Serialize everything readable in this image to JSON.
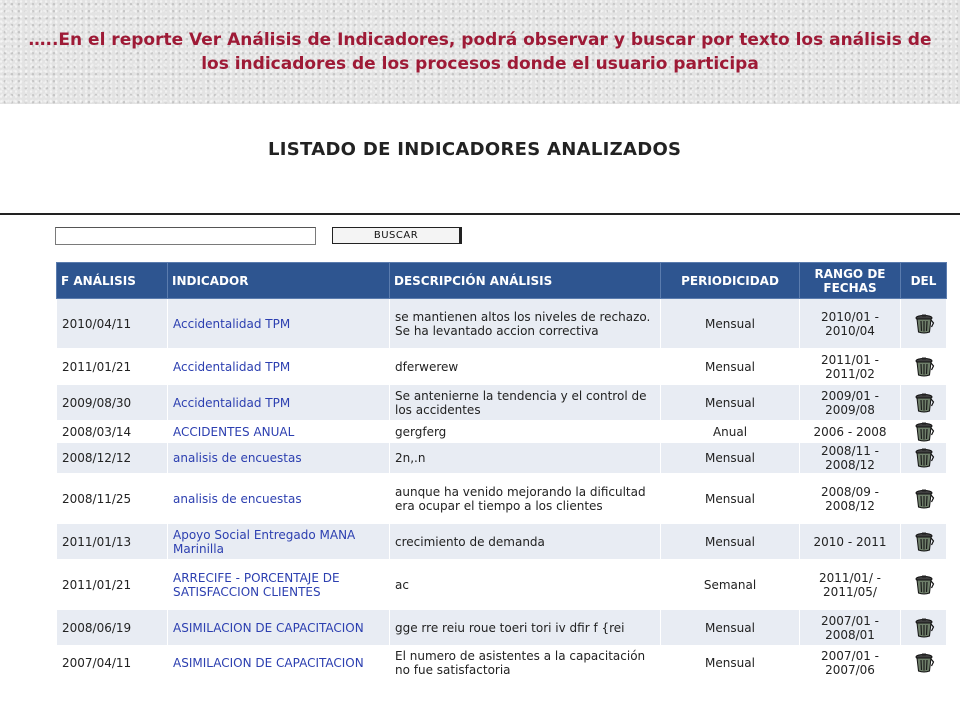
{
  "banner": {
    "text": "…..En el reporte Ver Análisis de Indicadores, podrá observar y buscar por texto los análisis de los indicadores de los procesos donde el usuario participa"
  },
  "page": {
    "title": "LISTADO DE INDICADORES ANALIZADOS"
  },
  "search": {
    "value": "",
    "button_label": "BUSCAR"
  },
  "table": {
    "headers": {
      "fecha": "F ANÁLISIS",
      "indicador": "INDICADOR",
      "descripcion": "DESCRIPCIÓN ANÁLISIS",
      "periodicidad": "PERIODICIDAD",
      "rango": "RANGO DE FECHAS",
      "del": "DEL"
    },
    "rows": [
      {
        "fecha": "2010/04/11",
        "indicador": "Accidentalidad TPM",
        "descripcion": "se mantienen altos los niveles de rechazo. Se ha levantado accion correctiva",
        "periodicidad": "Mensual",
        "rango": "2010/01 - 2010/04"
      },
      {
        "fecha": "2011/01/21",
        "indicador": "Accidentalidad TPM",
        "descripcion": "dferwerew",
        "periodicidad": "Mensual",
        "rango": "2011/01 - 2011/02"
      },
      {
        "fecha": "2009/08/30",
        "indicador": "Accidentalidad TPM",
        "descripcion": "Se antenierne la tendencia y el control de los accidentes",
        "periodicidad": "Mensual",
        "rango": "2009/01 - 2009/08"
      },
      {
        "fecha": "2008/03/14",
        "indicador": "ACCIDENTES ANUAL",
        "descripcion": "gergferg",
        "periodicidad": "Anual",
        "rango": "2006 - 2008"
      },
      {
        "fecha": "2008/12/12",
        "indicador": "analisis de encuestas",
        "descripcion": "2n,.n",
        "periodicidad": "Mensual",
        "rango": "2008/11 - 2008/12"
      },
      {
        "fecha": "2008/11/25",
        "indicador": "analisis de encuestas",
        "descripcion": "aunque ha venido mejorando la dificultad era ocupar el tiempo a los clientes",
        "periodicidad": "Mensual",
        "rango": "2008/09 - 2008/12"
      },
      {
        "fecha": "2011/01/13",
        "indicador": "Apoyo Social Entregado MANA Marinilla",
        "descripcion": "crecimiento de demanda",
        "periodicidad": "Mensual",
        "rango": "2010 - 2011"
      },
      {
        "fecha": "2011/01/21",
        "indicador": "ARRECIFE - PORCENTAJE DE SATISFACCION CLIENTES",
        "descripcion": "ac",
        "periodicidad": "Semanal",
        "rango": "2011/01/ - 2011/05/"
      },
      {
        "fecha": "2008/06/19",
        "indicador": "ASIMILACION DE CAPACITACION",
        "descripcion": "gge rre reiu roue toeri tori iv dfir f {rei",
        "periodicidad": "Mensual",
        "rango": "2007/01 - 2008/01"
      },
      {
        "fecha": "2007/04/11",
        "indicador": "ASIMILACION DE CAPACITACION",
        "descripcion": "El numero de asistentes a la capacitación no fue satisfactoria",
        "periodicidad": "Mensual",
        "rango": "2007/01 - 2007/06"
      }
    ]
  },
  "icons": {
    "delete": "trash-can-icon"
  },
  "colors": {
    "banner_text": "#9e1a36",
    "header_bg": "#2e5590",
    "link": "#2c3fb0",
    "row_alt": "#e8ecf3"
  }
}
